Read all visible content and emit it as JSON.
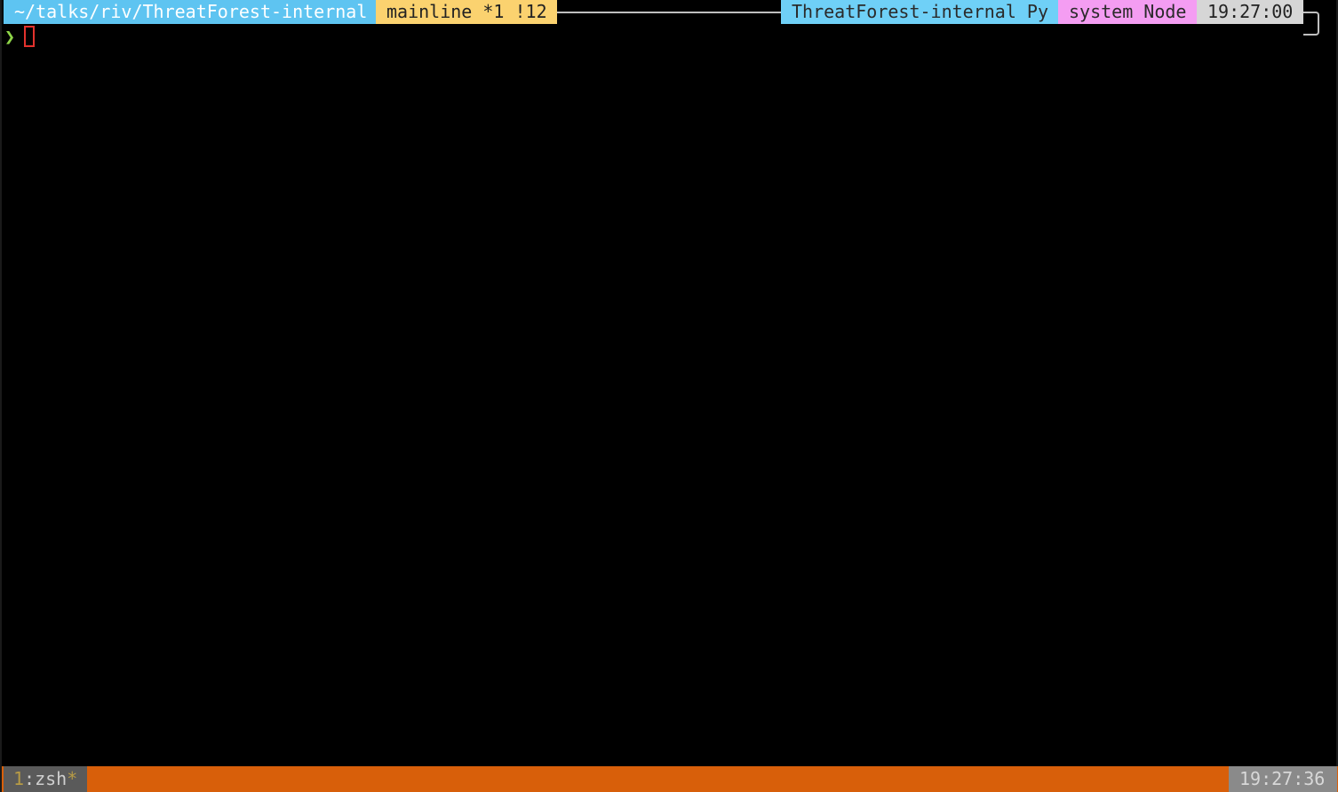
{
  "prompt": {
    "directory": "~/talks/riv/ThreatForest-internal",
    "git_status": "mainline *1 !12",
    "virtualenv": "ThreatForest-internal Py",
    "node_version": "system Node",
    "time": "19:27:00",
    "prompt_symbol": "❯",
    "colors": {
      "directory_bg": "#5ec4f1",
      "git_bg": "#fbd26f",
      "virtualenv_bg": "#6fd0f7",
      "node_bg": "#f49df2",
      "time_bg": "#d6d6d6",
      "prompt_symbol": "#8ed548",
      "cursor": "#e3322d"
    }
  },
  "statusbar": {
    "window_index": "1",
    "window_separator": ":",
    "window_name": "zsh",
    "window_flag": "*",
    "clock": "19:27:36",
    "colors": {
      "bar_bg": "#d85f0a",
      "window_tab_bg": "#5a5a5a",
      "clock_bg": "#8a8a8a"
    }
  }
}
